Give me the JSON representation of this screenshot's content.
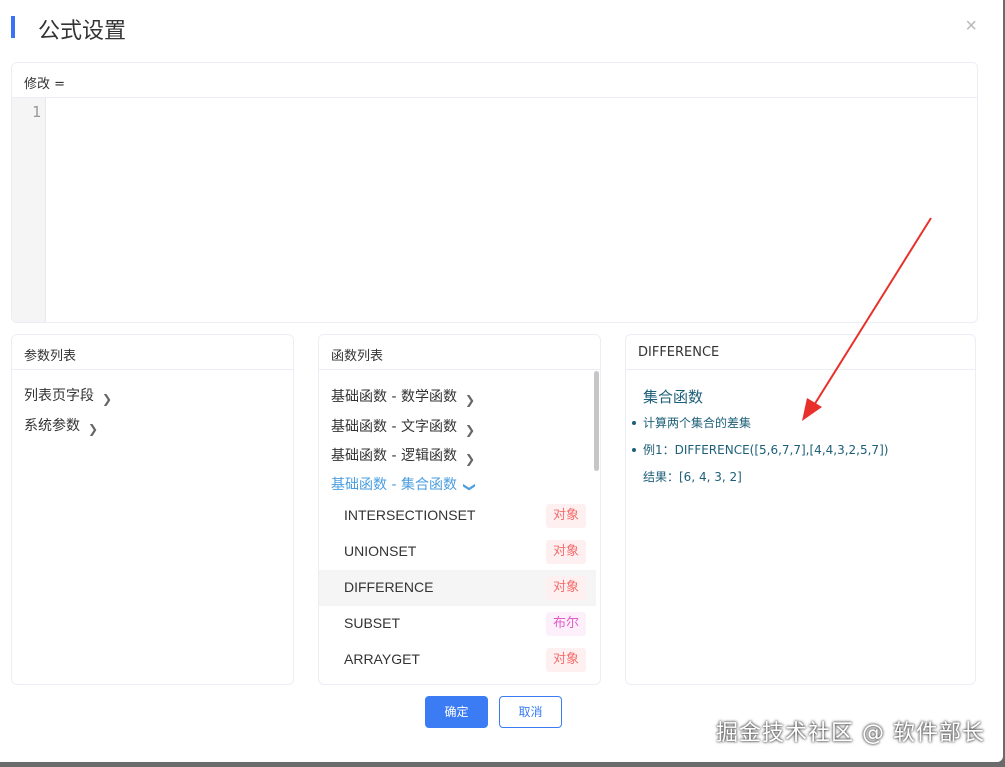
{
  "dialog": {
    "title": "公式设置",
    "close_icon": "×"
  },
  "editor": {
    "header_label": "修改 =",
    "line_number": "1",
    "content": ""
  },
  "params_panel": {
    "title": "参数列表",
    "items": [
      {
        "label": "列表页字段"
      },
      {
        "label": "系统参数"
      }
    ]
  },
  "functions_panel": {
    "title": "函数列表",
    "groups": [
      {
        "label": "基础函数 - 数学函数",
        "expanded": false
      },
      {
        "label": "基础函数 - 文字函数",
        "expanded": false
      },
      {
        "label": "基础函数 - 逻辑函数",
        "expanded": false
      },
      {
        "label": "基础函数 - 集合函数",
        "expanded": true
      }
    ],
    "functions": [
      {
        "name": "INTERSECTIONSET",
        "tag": "对象",
        "tag_type": "object"
      },
      {
        "name": "UNIONSET",
        "tag": "对象",
        "tag_type": "object"
      },
      {
        "name": "DIFFERENCE",
        "tag": "对象",
        "tag_type": "object",
        "selected": true
      },
      {
        "name": "SUBSET",
        "tag": "布尔",
        "tag_type": "boolean"
      },
      {
        "name": "ARRAYGET",
        "tag": "对象",
        "tag_type": "object"
      }
    ]
  },
  "doc_panel": {
    "title": "DIFFERENCE",
    "category": "集合函数",
    "description": "计算两个集合的差集",
    "example": "例1：DIFFERENCE([5,6,7,7],[4,4,3,2,5,7])",
    "result": "结果：[6, 4, 3, 2]"
  },
  "footer": {
    "ok_label": "确定",
    "cancel_label": "取消"
  },
  "watermark": "掘金技术社区 @ 软件部长",
  "colors": {
    "primary": "#3b7cf4",
    "accent_bar": "#3b72f2",
    "active_link": "#4a9ee0",
    "doc_text": "#1d5f78",
    "tag_object": "#f56c6c",
    "tag_boolean": "#e05cc8",
    "annotation_arrow": "#e8312a"
  }
}
